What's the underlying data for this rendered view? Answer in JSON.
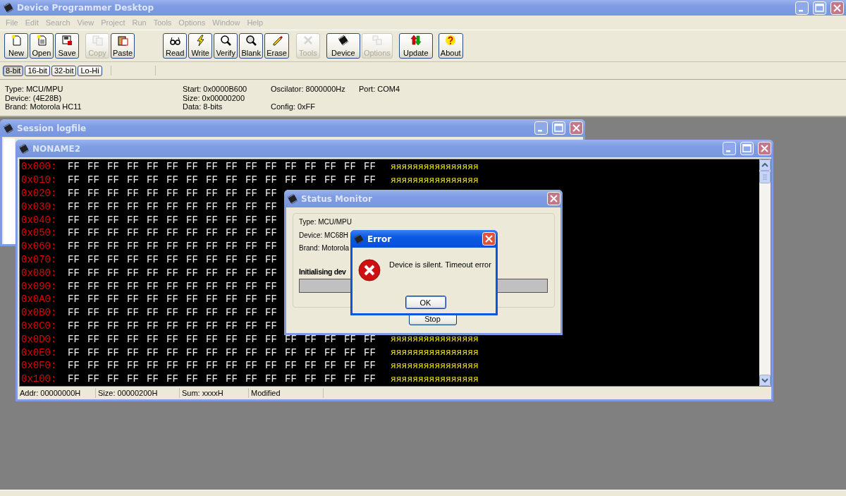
{
  "window": {
    "title": "Device Programmer Desktop"
  },
  "menu": [
    {
      "label": "File",
      "disabled": true
    },
    {
      "label": "Edit",
      "disabled": true
    },
    {
      "label": "Search",
      "disabled": true
    },
    {
      "label": "View",
      "disabled": true
    },
    {
      "label": "Project",
      "disabled": true
    },
    {
      "label": "Run",
      "disabled": true
    },
    {
      "label": "Tools",
      "disabled": true
    },
    {
      "label": "Options",
      "disabled": true
    },
    {
      "label": "Window",
      "disabled": true
    },
    {
      "label": "Help",
      "disabled": true
    }
  ],
  "toolbar": {
    "groups": [
      [
        {
          "label": "New",
          "disabled": false
        },
        {
          "label": "Open",
          "disabled": false
        },
        {
          "label": "Save",
          "disabled": false
        }
      ],
      [
        {
          "label": "Copy",
          "disabled": true
        },
        {
          "label": "Paste",
          "disabled": false
        }
      ],
      [
        {
          "label": "Read",
          "disabled": false
        },
        {
          "label": "Write",
          "disabled": false
        },
        {
          "label": "Verify",
          "disabled": false
        },
        {
          "label": "Blank",
          "disabled": false
        },
        {
          "label": "Erase",
          "disabled": false
        }
      ],
      [
        {
          "label": "Tools",
          "disabled": true
        }
      ],
      [
        {
          "label": "Device",
          "disabled": false
        },
        {
          "label": "Options",
          "disabled": true
        }
      ],
      [
        {
          "label": "Update",
          "disabled": false
        }
      ],
      [
        {
          "label": "About",
          "disabled": false
        }
      ]
    ]
  },
  "width_toolbar": [
    {
      "label": "8-bit",
      "selected": true
    },
    {
      "label": "16-bit",
      "selected": false
    },
    {
      "label": "32-bit",
      "selected": false
    },
    {
      "label": "Lo-Hi",
      "selected": false
    }
  ],
  "device_info": {
    "type": "Type: MCU/MPU",
    "device": "Device: (4E28B)",
    "brand": "Brand: Motorola HC11",
    "start": "Start: 0x0000B600",
    "size": "Size: 0x00000200",
    "data": "Data: 8-bits",
    "oscillator": "Oscilator: 8000000Hz",
    "config": "Config: 0xFF",
    "port": "Port: COM4"
  },
  "session_log": {
    "title": "Session logfile"
  },
  "hex_editor": {
    "title": "NONAME2",
    "rows": [
      {
        "address": "0x000:",
        "bytes": [
          "FF",
          "FF",
          "FF",
          "FF",
          "FF",
          "FF",
          "FF",
          "FF",
          "FF",
          "FF",
          "FF",
          "FF",
          "FF",
          "FF",
          "FF",
          "FF"
        ],
        "ascii": "яяяяяяяяяяяяяяяя"
      },
      {
        "address": "0x010:",
        "bytes": [
          "FF",
          "FF",
          "FF",
          "FF",
          "FF",
          "FF",
          "FF",
          "FF",
          "FF",
          "FF",
          "FF",
          "FF",
          "FF",
          "FF",
          "FF",
          "FF"
        ],
        "ascii": "яяяяяяяяяяяяяяяя"
      },
      {
        "address": "0x020:",
        "bytes": [
          "FF",
          "FF",
          "FF",
          "FF",
          "FF",
          "FF",
          "FF",
          "FF",
          "FF",
          "FF",
          "FF"
        ]
      },
      {
        "address": "0x030:",
        "bytes": [
          "FF",
          "FF",
          "FF",
          "FF",
          "FF",
          "FF",
          "FF",
          "FF",
          "FF",
          "FF",
          "FF"
        ]
      },
      {
        "address": "0x040:",
        "bytes": [
          "FF",
          "FF",
          "FF",
          "FF",
          "FF",
          "FF",
          "FF",
          "FF",
          "FF",
          "FF",
          "FF"
        ]
      },
      {
        "address": "0x050:",
        "bytes": [
          "FF",
          "FF",
          "FF",
          "FF",
          "FF",
          "FF",
          "FF",
          "FF",
          "FF",
          "FF",
          "FF"
        ]
      },
      {
        "address": "0x060:",
        "bytes": [
          "FF",
          "FF",
          "FF",
          "FF",
          "FF",
          "FF",
          "FF",
          "FF",
          "FF",
          "FF",
          "FF"
        ]
      },
      {
        "address": "0x070:",
        "bytes": [
          "FF",
          "FF",
          "FF",
          "FF",
          "FF",
          "FF",
          "FF",
          "FF",
          "FF",
          "FF",
          "FF"
        ]
      },
      {
        "address": "0x080:",
        "bytes": [
          "FF",
          "FF",
          "FF",
          "FF",
          "FF",
          "FF",
          "FF",
          "FF",
          "FF",
          "FF",
          "FF"
        ]
      },
      {
        "address": "0x090:",
        "bytes": [
          "FF",
          "FF",
          "FF",
          "FF",
          "FF",
          "FF",
          "FF",
          "FF",
          "FF",
          "FF",
          "FF"
        ]
      },
      {
        "address": "0x0A0:",
        "bytes": [
          "FF",
          "FF",
          "FF",
          "FF",
          "FF",
          "FF",
          "FF",
          "FF",
          "FF",
          "FF",
          "FF"
        ]
      },
      {
        "address": "0x0B0:",
        "bytes": [
          "FF",
          "FF",
          "FF",
          "FF",
          "FF",
          "FF",
          "FF",
          "FF",
          "FF",
          "FF",
          "FF"
        ]
      },
      {
        "address": "0x0C0:",
        "bytes": [
          "FF",
          "FF",
          "FF",
          "FF",
          "FF",
          "FF",
          "FF",
          "FF",
          "FF",
          "FF",
          "FF"
        ]
      },
      {
        "address": "0x0D0:",
        "bytes": [
          "FF",
          "FF",
          "FF",
          "FF",
          "FF",
          "FF",
          "FF",
          "FF",
          "FF",
          "FF",
          "FF",
          "FF",
          "FF",
          "FF",
          "FF",
          "FF"
        ],
        "ascii": "яяяяяяяяяяяяяяяя"
      },
      {
        "address": "0x0E0:",
        "bytes": [
          "FF",
          "FF",
          "FF",
          "FF",
          "FF",
          "FF",
          "FF",
          "FF",
          "FF",
          "FF",
          "FF",
          "FF",
          "FF",
          "FF",
          "FF",
          "FF"
        ],
        "ascii": "яяяяяяяяяяяяяяяя"
      },
      {
        "address": "0x0F0:",
        "bytes": [
          "FF",
          "FF",
          "FF",
          "FF",
          "FF",
          "FF",
          "FF",
          "FF",
          "FF",
          "FF",
          "FF",
          "FF",
          "FF",
          "FF",
          "FF",
          "FF"
        ],
        "ascii": "яяяяяяяяяяяяяяяя"
      },
      {
        "address": "0x100:",
        "bytes": [
          "FF",
          "FF",
          "FF",
          "FF",
          "FF",
          "FF",
          "FF",
          "FF",
          "FF",
          "FF",
          "FF",
          "FF",
          "FF",
          "FF",
          "FF",
          "FF"
        ],
        "ascii": "яяяяяяяяяяяяяяяя"
      }
    ],
    "status_bar": [
      "Addr: 00000000H",
      "Size: 00000200H",
      "Sum: xxxxH",
      "Modified"
    ]
  },
  "status_monitor": {
    "title": "Status Monitor",
    "lines": [
      "Type: MCU/MPU",
      "Device: MC68H",
      "Brand: Motorola"
    ],
    "progress_label": "Initialising dev",
    "progress": {
      "level": 0
    },
    "button": "Stop"
  },
  "error_dialog": {
    "title": "Error",
    "message": "Device is silent. Timeout error",
    "button": "OK"
  }
}
